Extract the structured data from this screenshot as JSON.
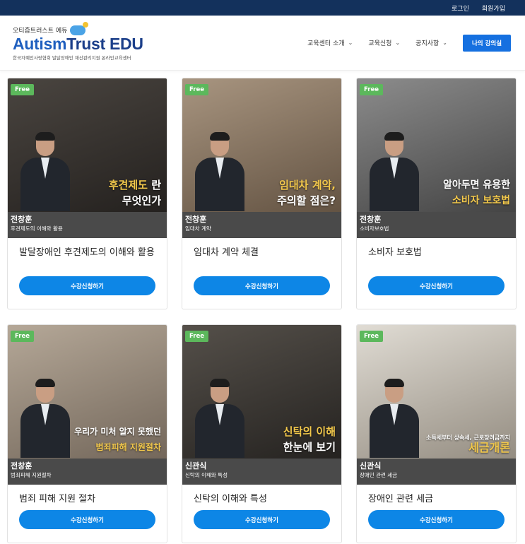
{
  "topbar": {
    "login": "로그인",
    "signup": "회원가입"
  },
  "logo": {
    "small": "오티즘트러스트 에듀",
    "main_a": "Autism",
    "main_b": "Trust EDU",
    "sub": "한국자폐인사랑협회 발달장애인 재산관리지원 온라인교육센터"
  },
  "nav": {
    "about": "교육센터 소개",
    "apply": "교육신청",
    "notice": "공지사항",
    "my_courses": "나의 강의실"
  },
  "badge_label": "Free",
  "enroll_label": "수강신청하기",
  "courses": [
    {
      "title": "발달장애인 후견제도의 이해와 활용",
      "instructor": "전창훈",
      "subtitle": "후견제도의 이해와 활용",
      "caption_hl": "후견제도",
      "caption_a": "란",
      "caption_b": "무엇인가",
      "bg": "#2e2b28"
    },
    {
      "title": "임대차 계약 체결",
      "instructor": "전창훈",
      "subtitle": "임대차 계약",
      "caption_hl": "임대차 계약,",
      "caption_a": "",
      "caption_b": "주의할 점은?",
      "bg": "#7a6a58"
    },
    {
      "title": "소비자 보호법",
      "instructor": "전창훈",
      "subtitle": "소비자보호법",
      "caption_hl": "",
      "caption_a": "알아두면 유용한",
      "caption_b": "소비자 보호법",
      "bg": "#5a5a5a"
    },
    {
      "title": "범죄 피해 지원 절차",
      "instructor": "전창훈",
      "subtitle": "범죄피해 지원절차",
      "caption_hl": "",
      "caption_a": "우리가 미처 알지 못했던",
      "caption_b": "범죄피해 지원절차",
      "bg": "#8a7d6e"
    },
    {
      "title": "신탁의 이해와 특성",
      "instructor": "신관식",
      "subtitle": "신탁의 이해와 특성",
      "caption_hl": "신탁의 이해",
      "caption_a": "",
      "caption_b": "한눈에 보기",
      "bg": "#33302c"
    },
    {
      "title": "장애인 관련 세금",
      "instructor": "신관식",
      "subtitle": "장애인 관련 세금",
      "caption_hl": "",
      "caption_a": "소득세부터 상속세, 근로장려금까지",
      "caption_b": "세금개론",
      "bg": "#b3aa9c"
    }
  ]
}
